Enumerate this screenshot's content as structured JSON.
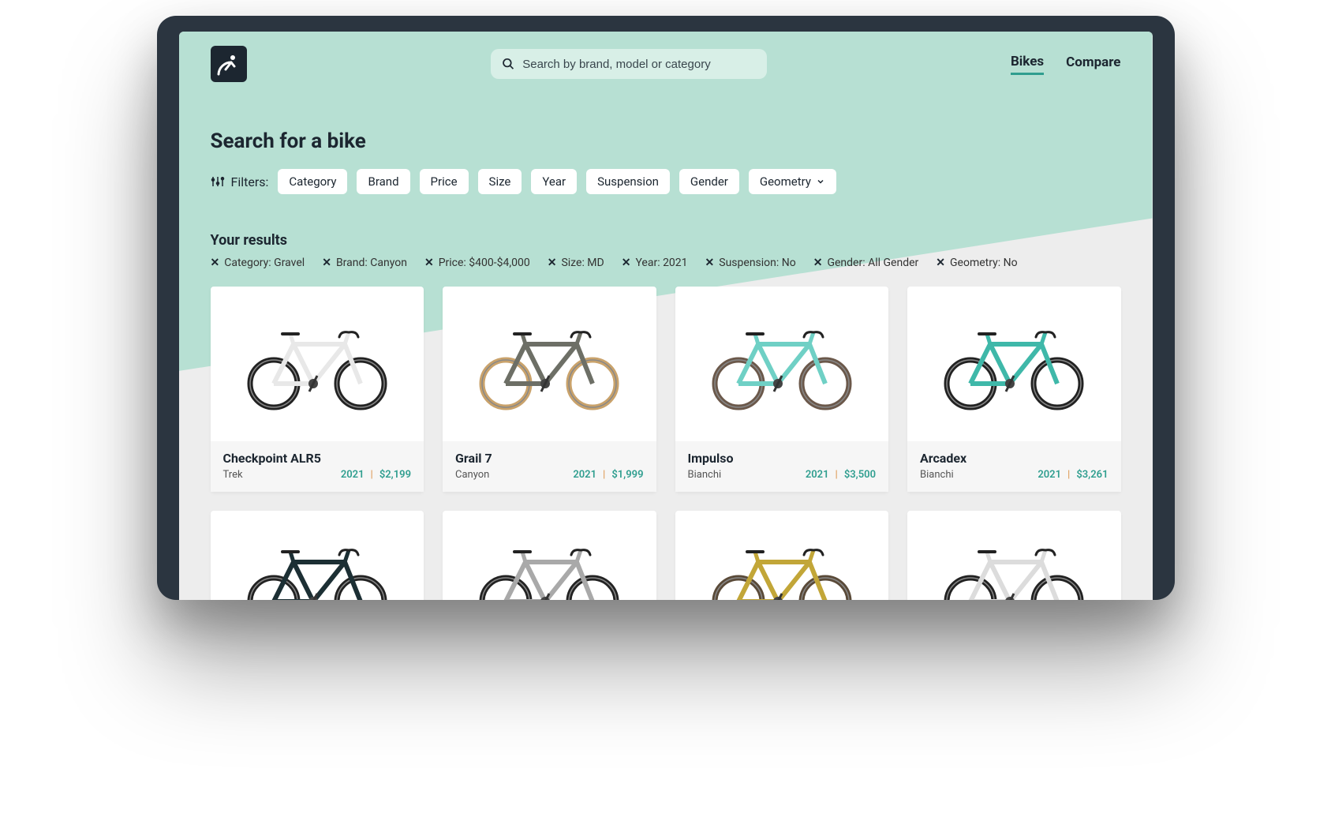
{
  "header": {
    "search_placeholder": "Search by brand, model or category",
    "nav": {
      "bikes": "Bikes",
      "compare": "Compare"
    }
  },
  "page_title": "Search for a bike",
  "filters_label": "Filters:",
  "filter_chips": {
    "category": "Category",
    "brand": "Brand",
    "price": "Price",
    "size": "Size",
    "year": "Year",
    "suspension": "Suspension",
    "gender": "Gender",
    "geometry": "Geometry"
  },
  "results_title": "Your results",
  "active_filters": {
    "category": "Category: Gravel",
    "brand": "Brand: Canyon",
    "price": "Price: $400-$4,000",
    "size": "Size: MD",
    "year": "Year: 2021",
    "suspension": "Suspension: No",
    "gender": "Gender: All Gender",
    "geometry": "Geometry: No"
  },
  "results": [
    {
      "name": "Checkpoint ALR5",
      "brand": "Trek",
      "year": "2021",
      "price": "$2,199",
      "frame": "#e8e8e8",
      "tire": "#222"
    },
    {
      "name": "Grail 7",
      "brand": "Canyon",
      "year": "2021",
      "price": "$1,999",
      "frame": "#6d6f66",
      "tire": "#c9a26b"
    },
    {
      "name": "Impulso",
      "brand": "Bianchi",
      "year": "2021",
      "price": "$3,500",
      "frame": "#6fd0c5",
      "tire": "#6b584a"
    },
    {
      "name": "Arcadex",
      "brand": "Bianchi",
      "year": "2021",
      "price": "$3,261",
      "frame": "#3fb8a9",
      "tire": "#222"
    }
  ],
  "row2_colors": [
    {
      "frame": "#1c2f34",
      "tire": "#222"
    },
    {
      "frame": "#a9a9a9",
      "tire": "#222"
    },
    {
      "frame": "#c2a638",
      "tire": "#5a4a38"
    },
    {
      "frame": "#dcdcdc",
      "tire": "#222"
    }
  ]
}
